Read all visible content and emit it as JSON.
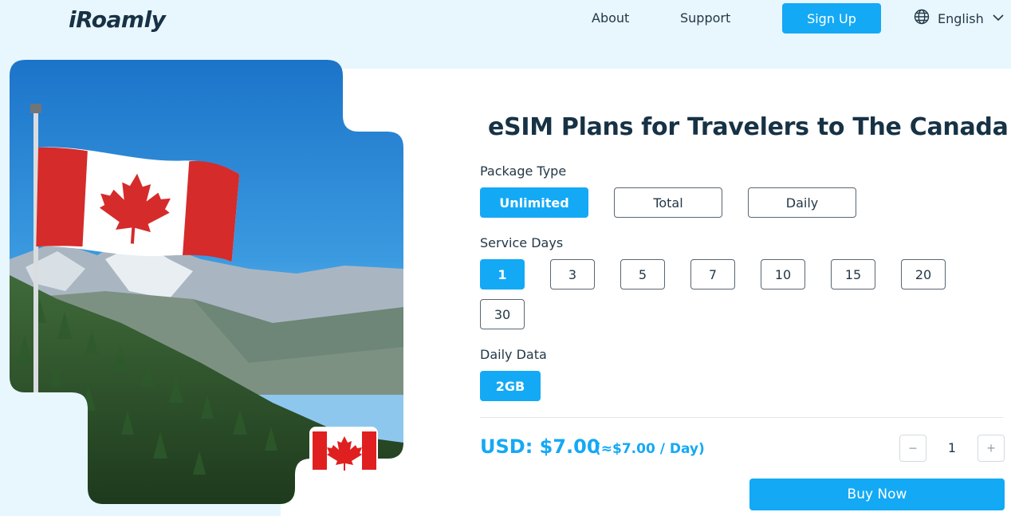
{
  "header": {
    "logo": "iRoamly",
    "nav": {
      "about": "About",
      "support": "Support"
    },
    "signup_label": "Sign Up",
    "language": "English",
    "icons": {
      "language": "globe-icon",
      "dropdown": "chevron-down-icon"
    }
  },
  "main": {
    "title": "eSIM Plans for Travelers to The Canada",
    "package_type": {
      "label": "Package Type",
      "options": [
        "Unlimited",
        "Total",
        "Daily"
      ],
      "selected": "Unlimited"
    },
    "service_days": {
      "label": "Service Days",
      "options": [
        "1",
        "3",
        "5",
        "7",
        "10",
        "15",
        "20",
        "30"
      ],
      "selected": "1"
    },
    "daily_data": {
      "label": "Daily Data",
      "options": [
        "2GB"
      ],
      "selected": "2GB"
    },
    "price": "USD: $7.00",
    "per_day": "(≈$7.00 / Day)",
    "quantity": "1",
    "stepper": {
      "minus": "−",
      "plus": "+"
    },
    "buy_label": "Buy Now"
  },
  "colors": {
    "accent": "#14a9f5",
    "page_background": "#e8f6fd",
    "heading": "#173245"
  }
}
